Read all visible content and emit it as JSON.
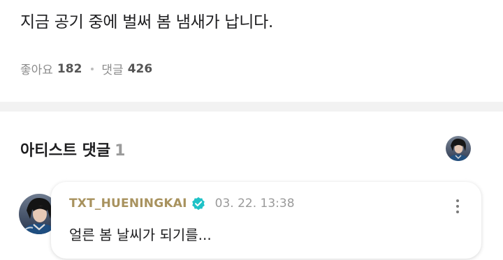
{
  "post": {
    "text": "지금 공기 중에 벌써 봄 냄새가 납니다.",
    "likes_label": "좋아요",
    "likes_count": "182",
    "comments_label": "댓글",
    "comments_count": "426"
  },
  "artist_comments": {
    "title": "아티스트 댓글",
    "count": "1",
    "header_avatar_icon": "artist-avatar-icon",
    "items": [
      {
        "author": "TXT_HUENINGKAI",
        "verified_icon": "verified-badge-icon",
        "timestamp": "03. 22. 13:38",
        "text": "얼른 봄 날씨가 되기를...",
        "more_icon": "more-vertical-icon"
      }
    ]
  },
  "colors": {
    "author": "#a8925e",
    "verified": "#1fc2c7",
    "divider": "#f2f2f2"
  }
}
